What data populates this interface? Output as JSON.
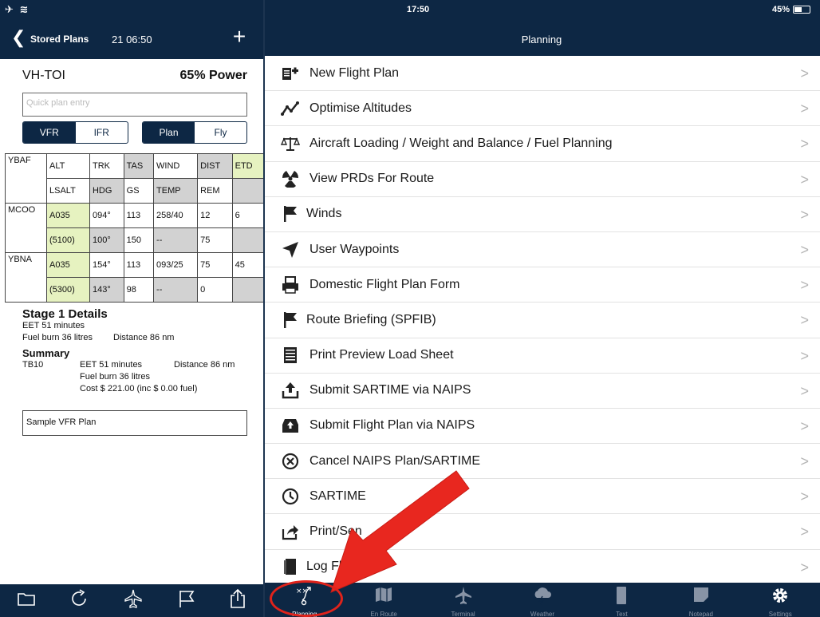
{
  "status": {
    "time": "17:50",
    "battery": "45%",
    "battery_level": 0.45
  },
  "left_nav": {
    "back_label": "Stored Plans",
    "time": "21 06:50",
    "add": "+"
  },
  "right_nav": {
    "title": "Planning"
  },
  "plan": {
    "aircraft": "VH-TOI",
    "power": "65% Power",
    "quick_placeholder": "Quick plan entry",
    "rules": [
      "VFR",
      "IFR"
    ],
    "mode": [
      "Plan",
      "Fly"
    ]
  },
  "legs": {
    "origin": "YBAF",
    "header1": [
      "ALT",
      "TRK",
      "TAS",
      "WIND",
      "DIST",
      "ETD"
    ],
    "header2": [
      "LSALT",
      "HDG",
      "GS",
      "TEMP",
      "REM",
      ""
    ],
    "rows": [
      {
        "wp": "MCOO",
        "r1": [
          "A035",
          "094°",
          "113",
          "258/40",
          "12",
          "6"
        ],
        "r2": [
          "(5100)",
          "100°",
          "150",
          "--",
          "75",
          ""
        ]
      },
      {
        "wp": "YBNA",
        "r1": [
          "A035",
          "154°",
          "113",
          "093/25",
          "75",
          "45"
        ],
        "r2": [
          "(5300)",
          "143°",
          "98",
          "--",
          "0",
          ""
        ]
      }
    ]
  },
  "details": {
    "stage_title": "Stage 1 Details",
    "eet": "EET 51 minutes",
    "fuel": "Fuel burn 36 litres",
    "distance": "Distance 86 nm",
    "summary_title": "Summary",
    "aircraft_type": "TB10",
    "sum_eet": "EET 51 minutes",
    "sum_distance": "Distance 86 nm",
    "sum_fuel": "Fuel burn 36 litres",
    "sum_cost": "Cost $ 221.00 (inc $ 0.00 fuel)",
    "plan_name": "Sample VFR Plan"
  },
  "menu": [
    {
      "label": "New Flight Plan",
      "icon": "new-plan-icon"
    },
    {
      "label": "Optimise Altitudes",
      "icon": "graph-icon"
    },
    {
      "label": "Aircraft Loading / Weight and Balance / Fuel Planning",
      "icon": "scale-icon"
    },
    {
      "label": "View PRDs For Route",
      "icon": "radiation-icon"
    },
    {
      "label": "Winds",
      "icon": "flag-icon"
    },
    {
      "label": "User Waypoints",
      "icon": "location-arrow-icon"
    },
    {
      "label": "Domestic Flight Plan Form",
      "icon": "printer-icon"
    },
    {
      "label": "Route Briefing (SPFIB)",
      "icon": "flag-icon"
    },
    {
      "label": "Print Preview Load Sheet",
      "icon": "document-icon"
    },
    {
      "label": "Submit SARTIME via NAIPS",
      "icon": "upload-icon"
    },
    {
      "label": "Submit Flight Plan via NAIPS",
      "icon": "inbox-upload-icon"
    },
    {
      "label": "Cancel NAIPS Plan/SARTIME",
      "icon": "cancel-circle-icon"
    },
    {
      "label": "SARTIME",
      "icon": "clock-icon"
    },
    {
      "label": "Print/Sen",
      "icon": "share-icon"
    },
    {
      "label": "Log Fli",
      "icon": "book-icon"
    }
  ],
  "tabs": [
    {
      "label": "Planning",
      "icon": "planning-icon"
    },
    {
      "label": "En Route",
      "icon": "map-icon"
    },
    {
      "label": "Terminal",
      "icon": "airplane-icon"
    },
    {
      "label": "Weather",
      "icon": "weather-icon"
    },
    {
      "label": "Text",
      "icon": "text-icon"
    },
    {
      "label": "Notepad",
      "icon": "notepad-icon"
    },
    {
      "label": "Settings",
      "icon": "gear-icon"
    }
  ],
  "colors": {
    "nav": "#0d2744",
    "highlight_green": "#e6f2c0",
    "cell_gray": "#d2d2d2",
    "annotation_red": "#e0231b"
  }
}
